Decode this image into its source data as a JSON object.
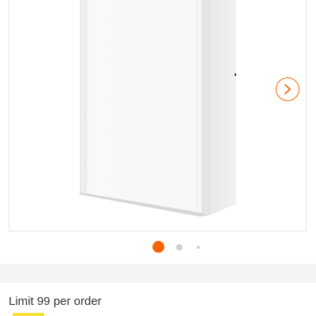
{
  "product": {
    "image_alt": "white wall cabinet",
    "next_icon": "chevron-right-icon",
    "accent_color": "#f96302"
  },
  "carousel": {
    "current_slide": 1,
    "total_slides": 3
  },
  "order": {
    "limit_text": "Limit 99 per order"
  }
}
